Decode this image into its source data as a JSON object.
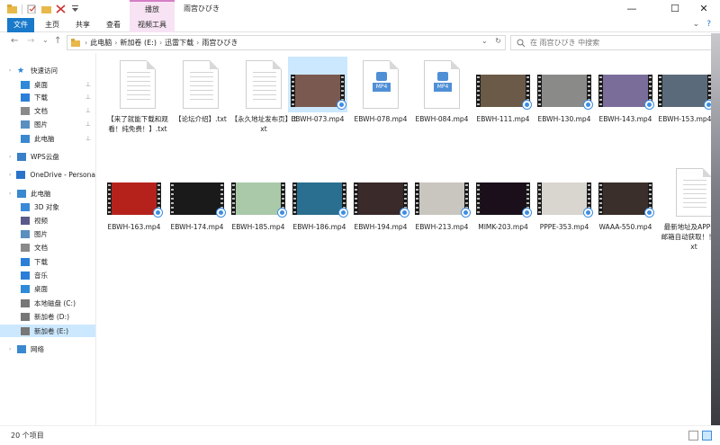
{
  "window": {
    "title": "雨宫ひびき",
    "context_tab_header": "播放",
    "controls": {
      "minimize": "—",
      "maximize": "☐",
      "close": "✕"
    }
  },
  "ribbon": {
    "tabs": [
      "文件",
      "主页",
      "共享",
      "查看",
      "视频工具"
    ],
    "expand": "⌄",
    "help": "?"
  },
  "address": {
    "back": "←",
    "forward": "→",
    "recent": "⌄",
    "up": "↑",
    "crumbs": [
      "此电脑",
      "新加卷 (E:)",
      "迅雷下载",
      "雨宫ひびき"
    ],
    "separator": "›",
    "dropdown": "⌄",
    "refresh": "↻",
    "search_placeholder": "在 雨宫ひびき 中搜索"
  },
  "sidebar": {
    "items": [
      {
        "label": "快速访问",
        "icon": "star-icon",
        "pinned": false
      },
      {
        "label": "桌面",
        "icon": "desktop-icon",
        "pinned": true
      },
      {
        "label": "下载",
        "icon": "download-icon",
        "pinned": true
      },
      {
        "label": "文档",
        "icon": "document-icon",
        "pinned": true
      },
      {
        "label": "图片",
        "icon": "pictures-icon",
        "pinned": true
      },
      {
        "label": "此电脑",
        "icon": "computer-icon",
        "pinned": true
      },
      {
        "label": "WPS云盘",
        "icon": "cloud-icon",
        "pinned": false
      },
      {
        "label": "OneDrive - Persona",
        "icon": "onedrive-icon",
        "pinned": false
      },
      {
        "label": "此电脑",
        "icon": "computer-icon",
        "pinned": false
      },
      {
        "label": "3D 对象",
        "icon": "cube-icon",
        "pinned": false
      },
      {
        "label": "视频",
        "icon": "video-icon",
        "pinned": false
      },
      {
        "label": "图片",
        "icon": "pictures-icon",
        "pinned": false
      },
      {
        "label": "文档",
        "icon": "document-icon",
        "pinned": false
      },
      {
        "label": "下载",
        "icon": "download-icon",
        "pinned": false
      },
      {
        "label": "音乐",
        "icon": "music-icon",
        "pinned": false
      },
      {
        "label": "桌面",
        "icon": "desktop-icon",
        "pinned": false
      },
      {
        "label": "本地磁盘 (C:)",
        "icon": "drive-icon",
        "pinned": false
      },
      {
        "label": "新加卷 (D:)",
        "icon": "drive-icon",
        "pinned": false
      },
      {
        "label": "新加卷 (E:)",
        "icon": "drive-icon",
        "pinned": false,
        "selected": true
      },
      {
        "label": "网络",
        "icon": "network-icon",
        "pinned": false
      }
    ],
    "pin_glyph": "📌"
  },
  "files": [
    {
      "name": "【来了就能下载和观看！纯免费！】.txt",
      "type": "txt"
    },
    {
      "name": "【论坛介绍】.txt",
      "type": "txt"
    },
    {
      "name": "【永久地址发布页】.txt",
      "type": "txt"
    },
    {
      "name": "EBWH-073.mp4",
      "type": "video",
      "thumb": "#7a5a50",
      "selected": true
    },
    {
      "name": "EBWH-078.mp4",
      "type": "mp4",
      "badge": "MP4"
    },
    {
      "name": "EBWH-084.mp4",
      "type": "mp4",
      "badge": "MP4"
    },
    {
      "name": "EBWH-111.mp4",
      "type": "video",
      "thumb": "#6b5a48"
    },
    {
      "name": "EBWH-130.mp4",
      "type": "video",
      "thumb": "#8a8a88"
    },
    {
      "name": "EBWH-143.mp4",
      "type": "video",
      "thumb": "#7a6d9a"
    },
    {
      "name": "EBWH-153.mp4",
      "type": "video",
      "thumb": "#5a6a7a"
    },
    {
      "name": "EBWH-163.mp4",
      "type": "video",
      "thumb": "#b5221c"
    },
    {
      "name": "EBWH-174.mp4",
      "type": "video",
      "thumb": "#1a1a1a"
    },
    {
      "name": "EBWH-185.mp4",
      "type": "video",
      "thumb": "#a9c9a9"
    },
    {
      "name": "EBWH-186.mp4",
      "type": "video",
      "thumb": "#2a6f8f"
    },
    {
      "name": "EBWH-194.mp4",
      "type": "video",
      "thumb": "#3a2a2a"
    },
    {
      "name": "EBWH-213.mp4",
      "type": "video",
      "thumb": "#c9c5bf"
    },
    {
      "name": "MIMK-203.mp4",
      "type": "video",
      "thumb": "#1a0f1a"
    },
    {
      "name": "PPPE-353.mp4",
      "type": "video",
      "thumb": "#d9d5cf"
    },
    {
      "name": "WAAA-550.mp4",
      "type": "video",
      "thumb": "#3a2f2a"
    },
    {
      "name": "最新地址及APP请发邮箱自动获取！！！.txt",
      "type": "txt"
    }
  ],
  "status": {
    "item_count": "20 个项目"
  },
  "colors": {
    "accent": "#1979ca",
    "selection": "#cce8ff",
    "context_tab": "#f7e3f3"
  }
}
